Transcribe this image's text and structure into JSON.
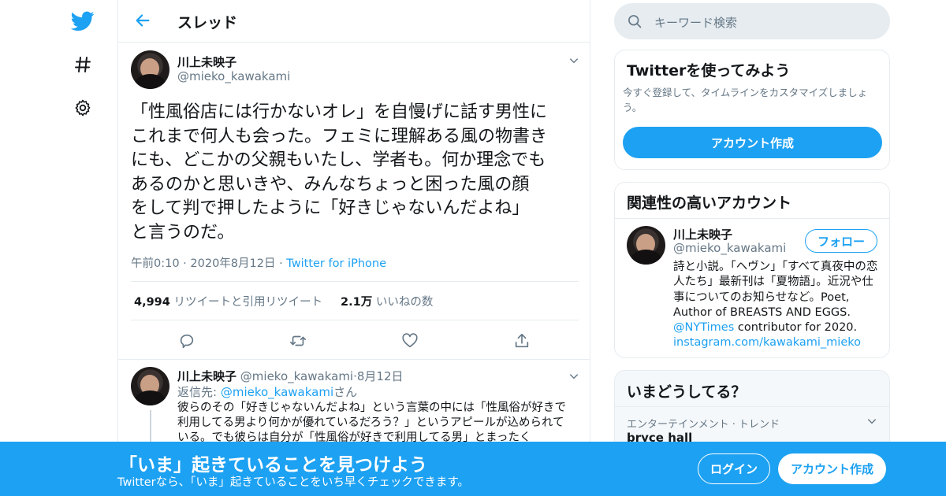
{
  "colors": {
    "accent": "#1da1f2",
    "text": "#14171a",
    "secondary": "#657786",
    "border": "#e6ecf0"
  },
  "nav": {
    "icons": [
      "twitter-bird-icon",
      "hashtag-icon",
      "gear-icon"
    ]
  },
  "header": {
    "title": "スレッド"
  },
  "tweet": {
    "name": "川上未映子",
    "handle": "@mieko_kawakami",
    "body": "「性風俗店には行かないオレ」を自慢げに話す男性に\nこれまで何人も会った。フェミに理解ある風の物書き\nにも、どこかの父親もいたし、学者も。何か理念でも\nあるのかと思いきや、みんなちょっと困った風の顔\nをして判で押したように「好きじゃないんだよね」\nと言うのだ。",
    "time": "午前0:10",
    "date": "2020年8月12日",
    "dot": "·",
    "source": "Twitter for iPhone",
    "retweets_count": "4,994",
    "retweets_label": "リツイートと引用リツイート",
    "likes_count": "2.1万",
    "likes_label": "いいねの数",
    "actions": [
      "reply-icon",
      "retweet-icon",
      "like-icon",
      "share-icon"
    ]
  },
  "reply": {
    "name": "川上未映子",
    "handle": "@mieko_kawakami",
    "dot": "·",
    "date": "8月12日",
    "reply_to_label": "返信先: ",
    "reply_to_handle": "@mieko_kawakami",
    "reply_to_suffix": "さん",
    "body": "彼らのその「好きじゃないんだよね」という言葉の中には「性風俗が好きで利用してる男より何かが優れているだろう？」というアピールが込められている。でも彼らは自分が「性風俗が好きで利用してる男」とまったく"
  },
  "search": {
    "placeholder": "キーワード検索"
  },
  "signup_card": {
    "title": "Twitterを使ってみよう",
    "desc": "今すぐ登録して、タイムラインをカスタマイズしましょう。",
    "button": "アカウント作成"
  },
  "related_card": {
    "title": "関連性の高いアカウント",
    "name": "川上未映子",
    "handle": "@mieko_kawakami",
    "follow": "フォロー",
    "bio_text": "詩と小説。「ヘヴン」「すべて真夜中の恋人たち」最新刊は「夏物語」。近況や仕事についてのお知らせなど。Poet, Author of BREASTS AND EGGS. ",
    "bio_link1": "@NYTimes",
    "bio_mid": " contributor for 2020. ",
    "bio_link2": "instagram.com/kawakami_mieko"
  },
  "trends_card": {
    "title": "いまどうしてる？",
    "category": "エンターテインメント · トレンド",
    "trend": "bryce hall"
  },
  "banner": {
    "title": "「いま」起きていることを見つけよう",
    "subtitle": "Twitterなら、「いま」起きていることをいち早くチェックできます。",
    "login": "ログイン",
    "signup": "アカウント作成"
  }
}
